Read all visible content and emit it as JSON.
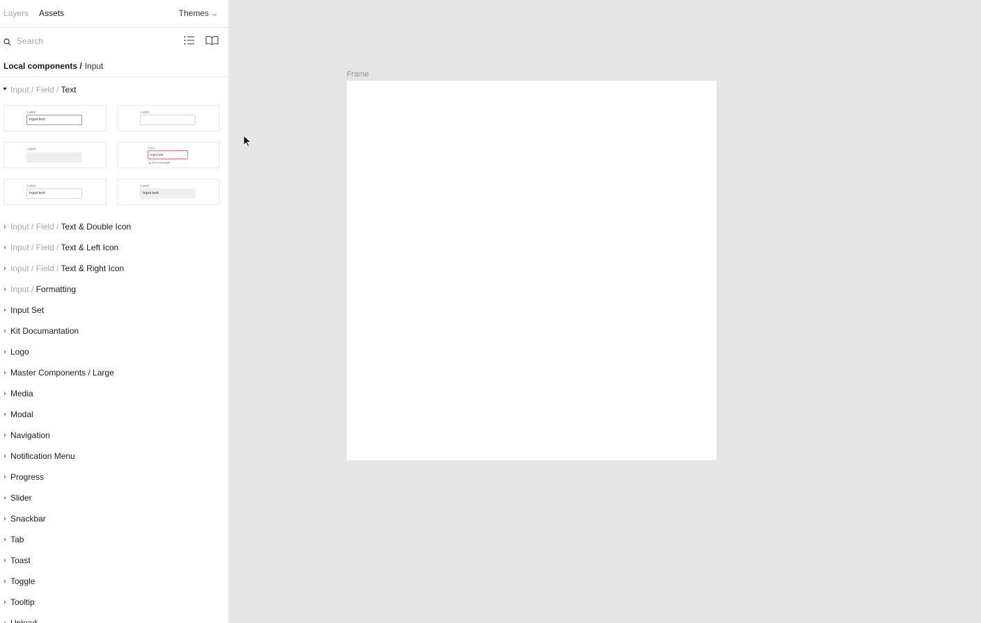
{
  "panel": {
    "tabs": {
      "layers": "Layers",
      "assets": "Assets"
    },
    "themes_label": "Themes",
    "search": {
      "placeholder": "Search",
      "value": ""
    },
    "breadcrumb": {
      "root": "Local components /",
      "current": "Input"
    },
    "open_group": {
      "prefix": "Input / Field / ",
      "name": "Text"
    },
    "previews": {
      "label": "Label",
      "input_text": "Input text",
      "error_message": "Error message"
    },
    "groups": [
      {
        "prefix": "Input / Field / ",
        "name": "Text & Double Icon"
      },
      {
        "prefix": "Input / Field / ",
        "name": "Text & Left Icon"
      },
      {
        "prefix": "Input / Field / ",
        "name": "Text & Right Icon"
      },
      {
        "prefix": "Input / ",
        "name": "Formatting"
      },
      {
        "prefix": "",
        "name": "Input Set"
      },
      {
        "prefix": "",
        "name": "Kit Documantation"
      },
      {
        "prefix": "",
        "name": "Logo"
      },
      {
        "prefix": "",
        "name": "Master Components / Large"
      },
      {
        "prefix": "",
        "name": "Media"
      },
      {
        "prefix": "",
        "name": "Modal"
      },
      {
        "prefix": "",
        "name": "Navigation"
      },
      {
        "prefix": "",
        "name": "Notification Menu"
      },
      {
        "prefix": "",
        "name": "Progress"
      },
      {
        "prefix": "",
        "name": "Slider"
      },
      {
        "prefix": "",
        "name": "Snackbar"
      },
      {
        "prefix": "",
        "name": "Tab"
      },
      {
        "prefix": "",
        "name": "Toast"
      },
      {
        "prefix": "",
        "name": "Toggle"
      },
      {
        "prefix": "",
        "name": "Tooltip"
      },
      {
        "prefix": "",
        "name": "Upload"
      }
    ]
  },
  "canvas": {
    "frame_label": "Frame"
  },
  "icons": {
    "search": "search-icon",
    "themes_chevron": "chevron-down-icon",
    "list_view": "list-view-icon",
    "library": "book-icon",
    "cursor": "pointer-cursor-icon"
  },
  "colors": {
    "canvas_bg": "#e5e5e5",
    "panel_bg": "#ffffff",
    "muted_text": "#a6a6a6",
    "error": "#e8435a",
    "focus": "#8c8cf0"
  }
}
